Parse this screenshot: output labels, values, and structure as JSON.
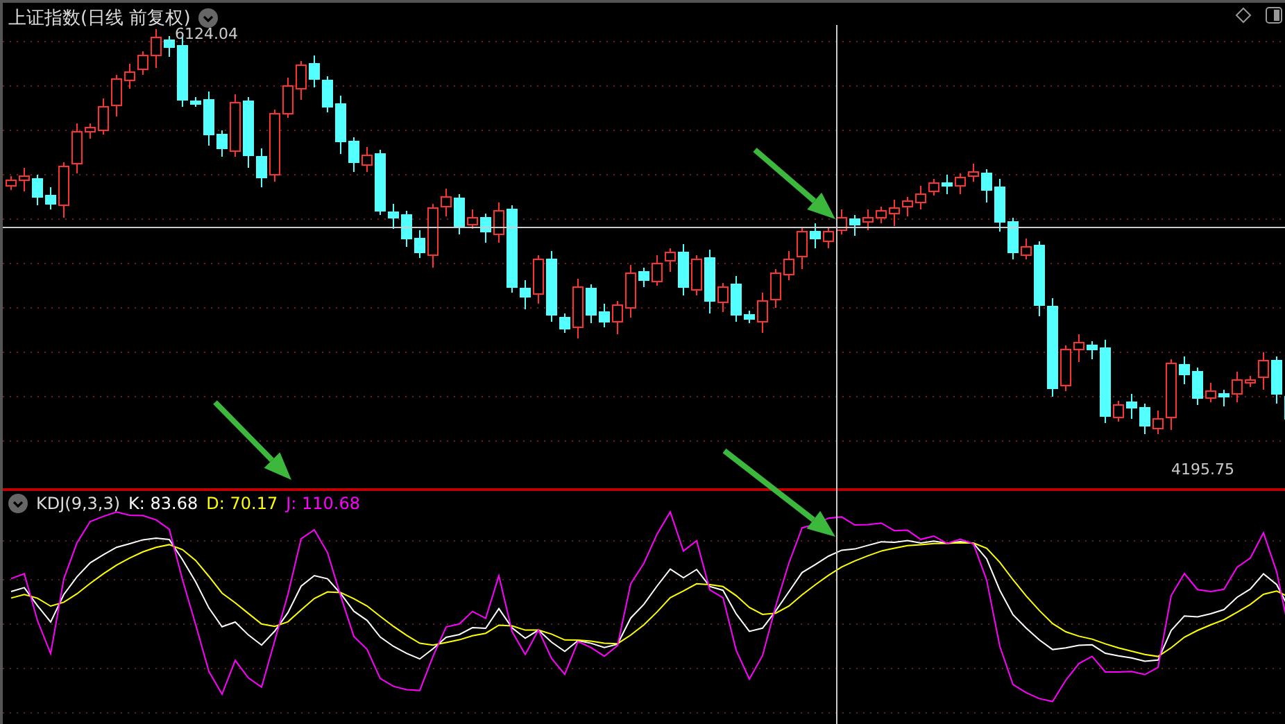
{
  "main_chart": {
    "title": "上证指数(日线 前复权)",
    "high_label": "6124.04",
    "low_label": "4195.75"
  },
  "indicator": {
    "name": "KDJ(9,3,3)",
    "readouts": [
      {
        "label": "K: 83.68",
        "color": "#ffffff"
      },
      {
        "label": "D: 70.17",
        "color": "#ffff00"
      },
      {
        "label": "J: 110.68",
        "color": "#ff00ff"
      }
    ]
  }
}
